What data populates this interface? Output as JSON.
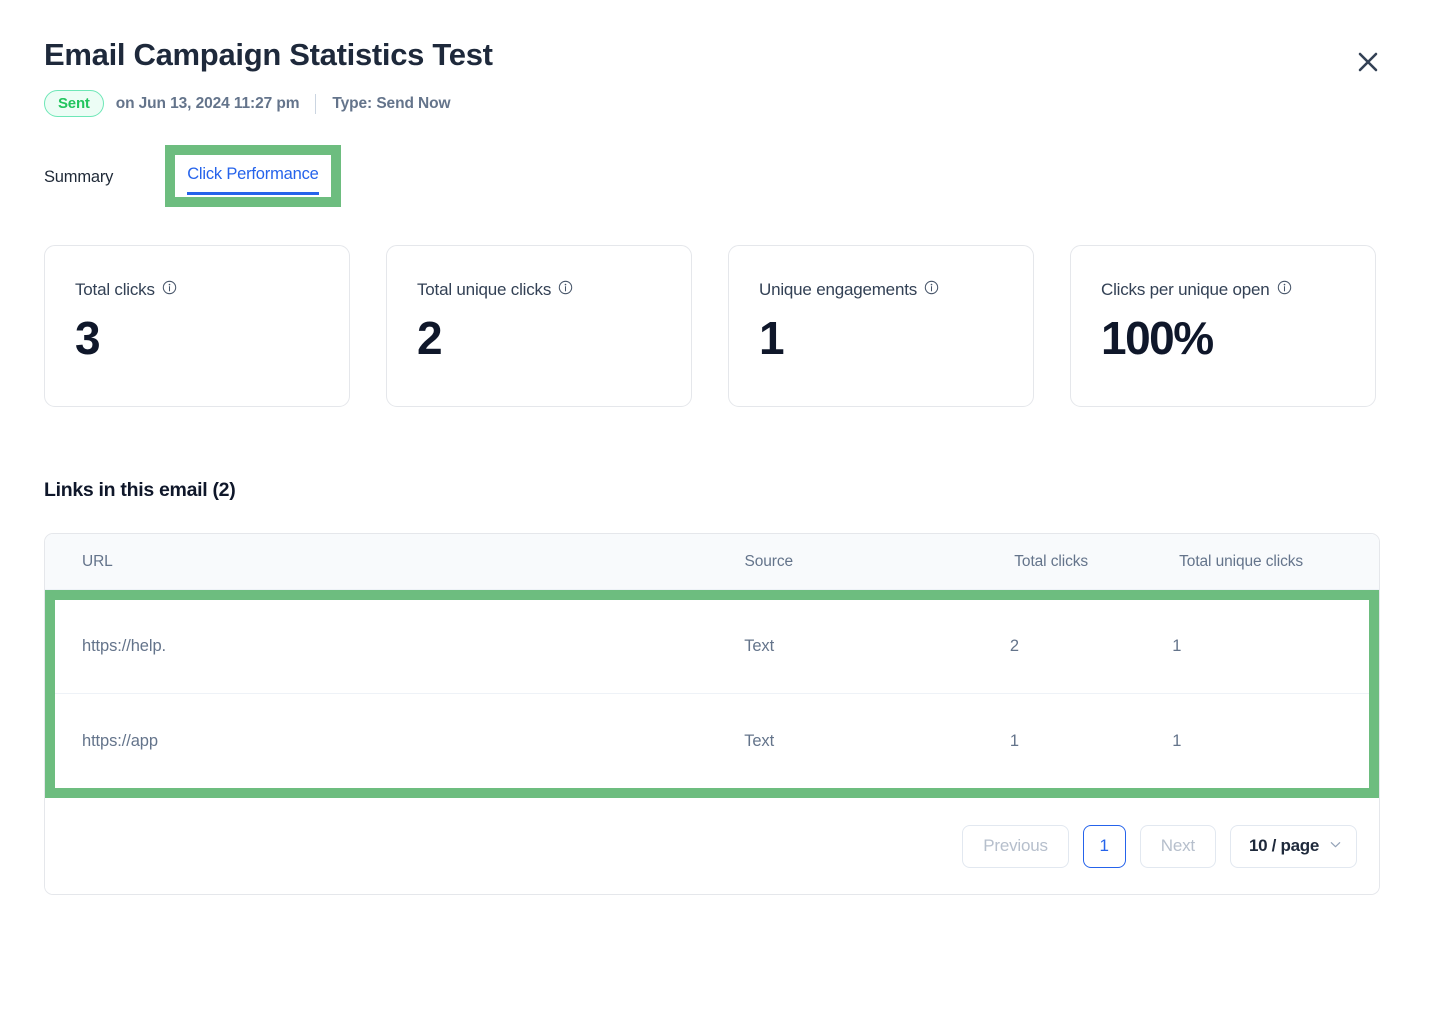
{
  "header": {
    "title": "Email Campaign Statistics Test",
    "status_badge": "Sent",
    "sent_on": "on Jun 13, 2024 11:27 pm",
    "type_label": "Type: Send Now",
    "close_icon": "close-icon",
    "badge_color": "#22c55e"
  },
  "tabs": [
    {
      "label": "Summary",
      "active": false
    },
    {
      "label": "Click Performance",
      "active": true
    }
  ],
  "accent_color": "#2563eb",
  "annotation_color": "#6dbd7f",
  "cards": [
    {
      "label": "Total clicks",
      "value": "3",
      "info_icon": "info-icon"
    },
    {
      "label": "Total unique clicks",
      "value": "2",
      "info_icon": "info-icon"
    },
    {
      "label": "Unique engagements",
      "value": "1",
      "info_icon": "info-icon"
    },
    {
      "label": "Clicks per unique open",
      "value": "100%",
      "info_icon": "info-icon"
    }
  ],
  "links_section": {
    "title": "Links in this email (2)",
    "columns": [
      "URL",
      "Source",
      "Total clicks",
      "Total unique clicks"
    ],
    "rows": [
      {
        "url": "https://help.",
        "source": "Text",
        "total_clicks": "2",
        "total_unique_clicks": "1"
      },
      {
        "url": "https://app",
        "source": "Text",
        "total_clicks": "1",
        "total_unique_clicks": "1"
      }
    ]
  },
  "pagination": {
    "previous_label": "Previous",
    "current_page": "1",
    "next_label": "Next",
    "page_size_label": "10 / page",
    "chevron_icon": "chevron-down-icon"
  }
}
